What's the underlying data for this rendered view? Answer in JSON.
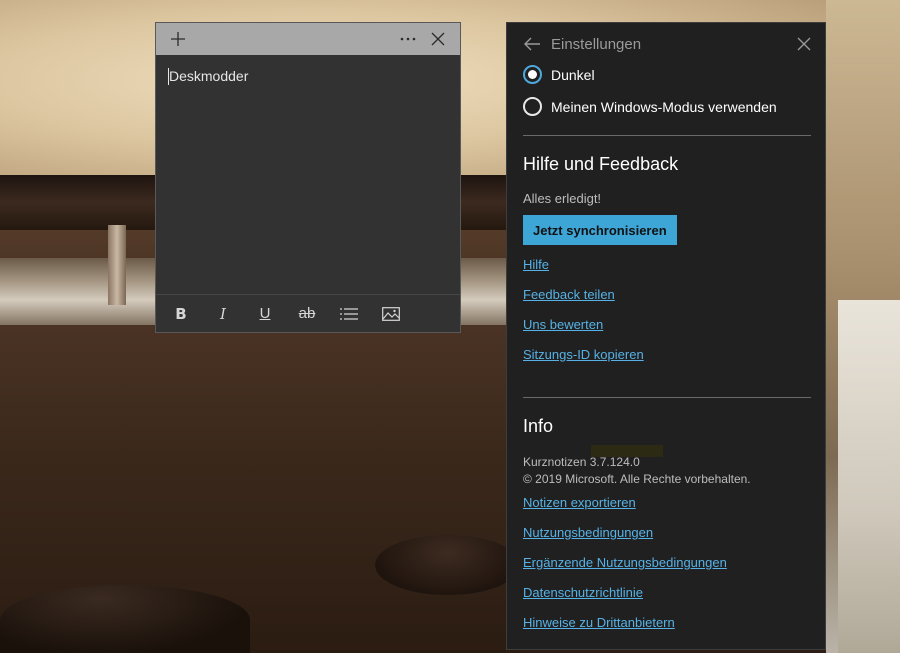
{
  "note": {
    "new_icon": "plus-icon",
    "menu_icon": "more-icon",
    "close_icon": "close-icon",
    "text": "Deskmodder",
    "toolbar": {
      "bold": "B",
      "italic": "I",
      "underline": "U",
      "strike": "ab",
      "list_icon": "list-icon",
      "image_icon": "image-icon"
    }
  },
  "settings": {
    "title": "Einstellungen",
    "back_icon": "back-arrow-icon",
    "close_icon": "close-icon",
    "theme": {
      "options": [
        {
          "label": "Dunkel",
          "checked": true
        },
        {
          "label": "Meinen Windows-Modus verwenden",
          "checked": false
        }
      ]
    },
    "help": {
      "heading": "Hilfe und Feedback",
      "status": "Alles erledigt!",
      "sync_button": "Jetzt synchronisieren",
      "links": [
        "Hilfe",
        "Feedback teilen",
        "Uns bewerten",
        "Sitzungs-ID kopieren"
      ]
    },
    "info": {
      "heading": "Info",
      "version": "Kurznotizen 3.7.124.0",
      "copyright": "© 2019 Microsoft. Alle Rechte vorbehalten.",
      "links": [
        "Notizen exportieren",
        "Nutzungsbedingungen",
        "Ergänzende Nutzungsbedingungen",
        "Datenschutzrichtlinie",
        "Hinweise zu Drittanbietern"
      ]
    },
    "accent_color": "#3ea6d7",
    "link_color": "#56b2e6"
  }
}
